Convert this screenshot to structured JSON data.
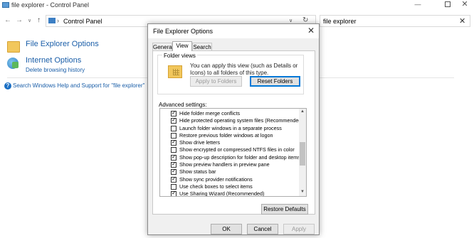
{
  "window": {
    "title": "file explorer - Control Panel",
    "minimize_glyph": "—",
    "close_glyph": "✕"
  },
  "nav": {
    "back_glyph": "←",
    "forward_glyph": "→",
    "recent_glyph": "∨",
    "up_glyph": "↑",
    "address_separator": "›",
    "breadcrumb": "Control Panel",
    "dropdown_glyph": "∨",
    "refresh_glyph": "↻"
  },
  "search": {
    "value": "file explorer",
    "clear_glyph": "✕"
  },
  "results": [
    {
      "title": "File Explorer Options",
      "icon": "folder-options-icon"
    },
    {
      "title": "Internet Options",
      "sub": "Delete browsing history",
      "icon": "internet-globe-icon"
    }
  ],
  "help_link": {
    "icon_glyph": "?",
    "text": "Search Windows Help and Support for \"file explorer\""
  },
  "dialog": {
    "title": "File Explorer Options",
    "close_glyph": "✕",
    "tabs": [
      "General",
      "View",
      "Search"
    ],
    "active_tab": "View",
    "folder_views": {
      "label": "Folder views",
      "description": "You can apply this view (such as Details or Icons) to all folders of this type.",
      "apply_button": "Apply to Folders",
      "reset_button": "Reset Folders"
    },
    "advanced_label": "Advanced settings:",
    "advanced_items": [
      {
        "label": "Hide folder merge conflicts",
        "checked": true
      },
      {
        "label": "Hide protected operating system files (Recommended)",
        "checked": true
      },
      {
        "label": "Launch folder windows in a separate process",
        "checked": false
      },
      {
        "label": "Restore previous folder windows at logon",
        "checked": false
      },
      {
        "label": "Show drive letters",
        "checked": true
      },
      {
        "label": "Show encrypted or compressed NTFS files in color",
        "checked": false
      },
      {
        "label": "Show pop-up description for folder and desktop items",
        "checked": true
      },
      {
        "label": "Show preview handlers in preview pane",
        "checked": true
      },
      {
        "label": "Show status bar",
        "checked": true
      },
      {
        "label": "Show sync provider notifications",
        "checked": true
      },
      {
        "label": "Use check boxes to select items",
        "checked": false
      },
      {
        "label": "Use Sharing Wizard (Recommended)",
        "checked": true
      }
    ],
    "scroll_up_glyph": "▲",
    "scroll_down_glyph": "▼",
    "restore_defaults": "Restore Defaults",
    "ok": "OK",
    "cancel": "Cancel",
    "apply": "Apply"
  }
}
